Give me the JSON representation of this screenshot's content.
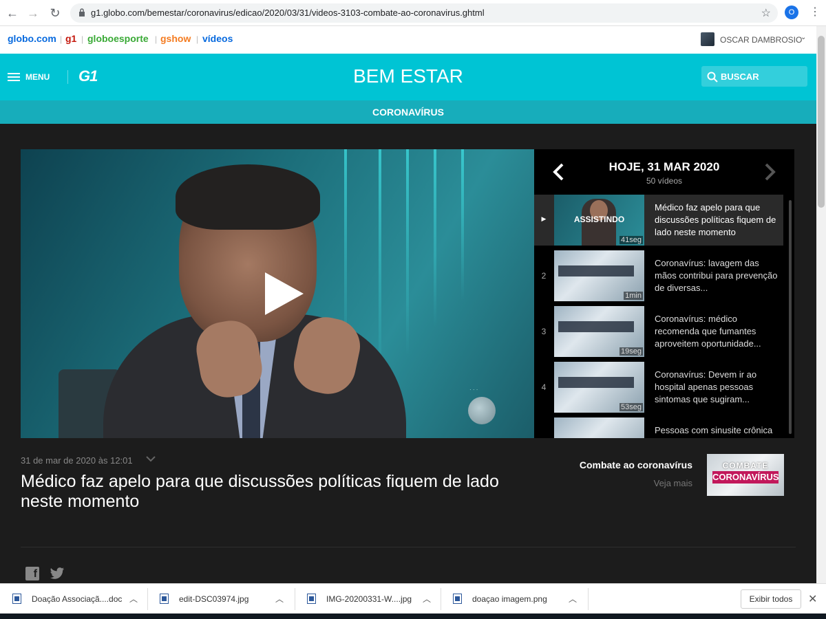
{
  "browser": {
    "url": "g1.globo.com/bemestar/coronavirus/edicao/2020/03/31/videos-3103-combate-ao-coronavirus.ghtml",
    "profile_initial": "O"
  },
  "globobar": {
    "links": [
      "globo.com",
      "g1",
      "globoesporte",
      "gshow",
      "vídeos"
    ],
    "user_name": "OSCAR DAMBROSIO"
  },
  "header": {
    "menu_label": "MENU",
    "logo": "G1",
    "title": "BEM ESTAR",
    "search_label": "BUSCAR",
    "section": "CORONAVÍRUS"
  },
  "playlist": {
    "date": "HOJE, 31 MAR 2020",
    "count": "50 vídeos",
    "watching_label": "ASSISTINDO",
    "items": [
      {
        "num": "",
        "title": "Médico faz apelo para que discussões políticas fiquem de lado neste momento",
        "duration": "41seg"
      },
      {
        "num": "2",
        "title": "Coronavírus: lavagem das mãos contribui para prevenção de diversas...",
        "duration": "1min"
      },
      {
        "num": "3",
        "title": "Coronavírus: médico recomenda que fumantes aproveitem oportunidade...",
        "duration": "19seg"
      },
      {
        "num": "4",
        "title": "Coronavírus: Devem ir ao hospital apenas pessoas sintomas que sugiram...",
        "duration": "53seg"
      },
      {
        "num": "",
        "title": "Pessoas com sinusite crônica",
        "duration": ""
      }
    ]
  },
  "video": {
    "date": "31 de mar de 2020 às 12:01",
    "title": "Médico faz apelo para que discussões políticas fiquem de lado neste momento"
  },
  "related": {
    "label": "Combate ao coronavírus",
    "more": "Veja mais",
    "image_text_top": "COMBATE",
    "image_text_bottom": "CORONAVÍRUS"
  },
  "downloads": {
    "files": [
      "Doação Associaçã....doc",
      "edit-DSC03974.jpg",
      "IMG-20200331-W....jpg",
      "doaçao imagem.png"
    ],
    "show_all": "Exibir todos"
  },
  "colors": {
    "header": "#00c4d4",
    "subheader": "#17adbb",
    "page_bg": "#1c1c1c"
  }
}
